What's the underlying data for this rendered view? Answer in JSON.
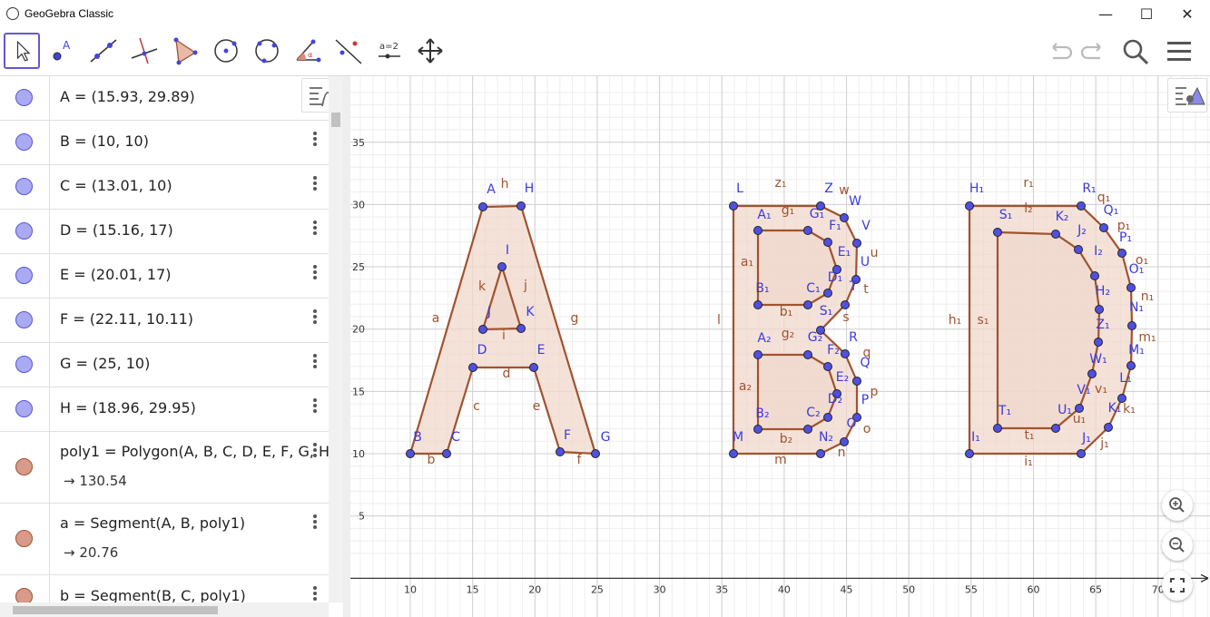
{
  "window": {
    "title": "GeoGebra Classic",
    "minimize": "—",
    "maximize": "☐",
    "close": "✕"
  },
  "toolbar": {
    "tools": [
      "move-tool",
      "point-tool",
      "line-tool",
      "perpendicular-line-tool",
      "polygon-tool",
      "circle-center-point-tool",
      "circle-three-points-tool",
      "angle-tool",
      "reflect-tool",
      "slider-tool",
      "move-graphics-tool"
    ],
    "slider_label": "a=2",
    "accent_color": "#6557d2"
  },
  "algebra": {
    "rows": [
      {
        "expr": "A = (15.93, 29.89)"
      },
      {
        "expr": "B = (10, 10)"
      },
      {
        "expr": "C = (13.01, 10)"
      },
      {
        "expr": "D = (15.16, 17)"
      },
      {
        "expr": "E = (20.01, 17)"
      },
      {
        "expr": "F = (22.11, 10.11)"
      },
      {
        "expr": "G = (25, 10)"
      },
      {
        "expr": "H = (18.96, 29.95)"
      },
      {
        "expr": "poly1 = Polygon(A, B, C, D, E, F, G, H)",
        "value": "→  130.54"
      },
      {
        "expr": "a = Segment(A, B, poly1)",
        "value": "→  20.76"
      },
      {
        "expr": "b = Segment(B, C, poly1)"
      }
    ]
  },
  "graphics": {
    "x_ticks": [
      "10",
      "15",
      "20",
      "25",
      "30",
      "35",
      "40",
      "45",
      "50",
      "55",
      "60",
      "65",
      "70"
    ],
    "y_ticks": [
      "35",
      "30",
      "25",
      "20",
      "15",
      "10",
      "5"
    ],
    "labels": [
      {
        "t": "A",
        "c": "p",
        "x": 541,
        "y": 213
      },
      {
        "t": "H",
        "c": "p",
        "x": 583,
        "y": 212
      },
      {
        "t": "h",
        "c": "s",
        "x": 556,
        "y": 207
      },
      {
        "t": "I",
        "c": "p",
        "x": 559,
        "y": 280
      },
      {
        "t": "k",
        "c": "s",
        "x": 531,
        "y": 320
      },
      {
        "t": "j",
        "c": "s",
        "x": 579,
        "y": 319
      },
      {
        "t": "J",
        "c": "p",
        "x": 539,
        "y": 348
      },
      {
        "t": "K",
        "c": "p",
        "x": 584,
        "y": 348
      },
      {
        "t": "i",
        "c": "s",
        "x": 555,
        "y": 374
      },
      {
        "t": "a",
        "c": "s",
        "x": 480,
        "y": 355
      },
      {
        "t": "g",
        "c": "s",
        "x": 633,
        "y": 355
      },
      {
        "t": "D",
        "c": "p",
        "x": 531,
        "y": 390
      },
      {
        "t": "E",
        "c": "p",
        "x": 596,
        "y": 390
      },
      {
        "t": "d",
        "c": "s",
        "x": 558,
        "y": 416
      },
      {
        "t": "c",
        "c": "s",
        "x": 525,
        "y": 452
      },
      {
        "t": "e",
        "c": "s",
        "x": 591,
        "y": 452
      },
      {
        "t": "B",
        "c": "p",
        "x": 460,
        "y": 486
      },
      {
        "t": "C",
        "c": "p",
        "x": 502,
        "y": 486
      },
      {
        "t": "F",
        "c": "p",
        "x": 625,
        "y": 484
      },
      {
        "t": "G",
        "c": "p",
        "x": 667,
        "y": 486
      },
      {
        "t": "b",
        "c": "s",
        "x": 475,
        "y": 511
      },
      {
        "t": "f",
        "c": "s",
        "x": 638,
        "y": 511
      },
      {
        "t": "L",
        "c": "p",
        "x": 815,
        "y": 212
      },
      {
        "t": "Z",
        "c": "p",
        "x": 913,
        "y": 212
      },
      {
        "t": "W",
        "c": "p",
        "x": 942,
        "y": 226
      },
      {
        "t": "w",
        "c": "s",
        "x": 930,
        "y": 214
      },
      {
        "t": "z₁",
        "c": "s",
        "x": 860,
        "y": 206
      },
      {
        "t": "A₁",
        "c": "p",
        "x": 842,
        "y": 241
      },
      {
        "t": "g₁",
        "c": "s",
        "x": 868,
        "y": 236
      },
      {
        "t": "G₁",
        "c": "p",
        "x": 900,
        "y": 240
      },
      {
        "t": "F₁",
        "c": "p",
        "x": 920,
        "y": 253
      },
      {
        "t": "V",
        "c": "p",
        "x": 954,
        "y": 253
      },
      {
        "t": "E₁",
        "c": "p",
        "x": 930,
        "y": 282
      },
      {
        "t": "U",
        "c": "p",
        "x": 953,
        "y": 293
      },
      {
        "t": "u",
        "c": "s",
        "x": 963,
        "y": 283
      },
      {
        "t": "a₁",
        "c": "s",
        "x": 823,
        "y": 293
      },
      {
        "t": "D₁",
        "c": "p",
        "x": 920,
        "y": 310
      },
      {
        "t": "T",
        "c": "p",
        "x": 940,
        "y": 320
      },
      {
        "t": "t",
        "c": "s",
        "x": 954,
        "y": 323
      },
      {
        "t": "B₁",
        "c": "p",
        "x": 840,
        "y": 322
      },
      {
        "t": "C₁",
        "c": "p",
        "x": 896,
        "y": 322
      },
      {
        "t": "b₁",
        "c": "s",
        "x": 866,
        "y": 348
      },
      {
        "t": "S₁",
        "c": "p",
        "x": 910,
        "y": 347
      },
      {
        "t": "s",
        "c": "s",
        "x": 932,
        "y": 354
      },
      {
        "t": "l",
        "c": "s",
        "x": 792,
        "y": 357
      },
      {
        "t": "A₂",
        "c": "p",
        "x": 842,
        "y": 377
      },
      {
        "t": "g₂",
        "c": "s",
        "x": 868,
        "y": 372
      },
      {
        "t": "G₂",
        "c": "p",
        "x": 898,
        "y": 376
      },
      {
        "t": "R",
        "c": "p",
        "x": 940,
        "y": 376
      },
      {
        "t": "F₂",
        "c": "p",
        "x": 918,
        "y": 390
      },
      {
        "t": "q",
        "c": "s",
        "x": 955,
        "y": 393
      },
      {
        "t": "Q",
        "c": "p",
        "x": 953,
        "y": 404
      },
      {
        "t": "E₂",
        "c": "p",
        "x": 928,
        "y": 420
      },
      {
        "t": "a₂",
        "c": "s",
        "x": 821,
        "y": 430
      },
      {
        "t": "P",
        "c": "p",
        "x": 953,
        "y": 445
      },
      {
        "t": "p",
        "c": "s",
        "x": 963,
        "y": 436
      },
      {
        "t": "D₂",
        "c": "p",
        "x": 920,
        "y": 444
      },
      {
        "t": "B₂",
        "c": "p",
        "x": 840,
        "y": 460
      },
      {
        "t": "C₂",
        "c": "p",
        "x": 896,
        "y": 459
      },
      {
        "t": "O",
        "c": "p",
        "x": 938,
        "y": 471
      },
      {
        "t": "o",
        "c": "s",
        "x": 955,
        "y": 477
      },
      {
        "t": "M",
        "c": "p",
        "x": 813,
        "y": 486
      },
      {
        "t": "N₂",
        "c": "p",
        "x": 910,
        "y": 486
      },
      {
        "t": "b₂",
        "c": "s",
        "x": 866,
        "y": 488
      },
      {
        "t": "m",
        "c": "s",
        "x": 860,
        "y": 511
      },
      {
        "t": "n",
        "c": "s",
        "x": 927,
        "y": 503
      },
      {
        "t": "H₁",
        "c": "p",
        "x": 1076,
        "y": 212
      },
      {
        "t": "r₁",
        "c": "s",
        "x": 1133,
        "y": 206
      },
      {
        "t": "R₁",
        "c": "p",
        "x": 1200,
        "y": 212
      },
      {
        "t": "q₁",
        "c": "s",
        "x": 1216,
        "y": 222
      },
      {
        "t": "Q₁",
        "c": "p",
        "x": 1224,
        "y": 236
      },
      {
        "t": "l₂",
        "c": "s",
        "x": 1133,
        "y": 234
      },
      {
        "t": "S₁",
        "c": "p",
        "x": 1108,
        "y": 241
      },
      {
        "t": "K₂",
        "c": "p",
        "x": 1170,
        "y": 243
      },
      {
        "t": "p₁",
        "c": "s",
        "x": 1238,
        "y": 253
      },
      {
        "t": "P₁",
        "c": "p",
        "x": 1240,
        "y": 266
      },
      {
        "t": "J₂",
        "c": "p",
        "x": 1192,
        "y": 258
      },
      {
        "t": "I₂",
        "c": "p",
        "x": 1210,
        "y": 281
      },
      {
        "t": "o₁",
        "c": "s",
        "x": 1258,
        "y": 291
      },
      {
        "t": "O₁",
        "c": "p",
        "x": 1252,
        "y": 301
      },
      {
        "t": "H₂",
        "c": "p",
        "x": 1215,
        "y": 325
      },
      {
        "t": "n₁",
        "c": "s",
        "x": 1264,
        "y": 331
      },
      {
        "t": "N₁",
        "c": "p",
        "x": 1252,
        "y": 343
      },
      {
        "t": "h₁",
        "c": "s",
        "x": 1052,
        "y": 357
      },
      {
        "t": "s₁",
        "c": "s",
        "x": 1083,
        "y": 357
      },
      {
        "t": "Z₁",
        "c": "p",
        "x": 1215,
        "y": 362
      },
      {
        "t": "m₁",
        "c": "s",
        "x": 1264,
        "y": 376
      },
      {
        "t": "M₁",
        "c": "p",
        "x": 1252,
        "y": 390
      },
      {
        "t": "W₁",
        "c": "p",
        "x": 1210,
        "y": 400
      },
      {
        "t": "L₁",
        "c": "p",
        "x": 1240,
        "y": 421
      },
      {
        "t": "V₁",
        "c": "p",
        "x": 1194,
        "y": 434
      },
      {
        "t": "v₁",
        "c": "s",
        "x": 1213,
        "y": 433
      },
      {
        "t": "k₁",
        "c": "s",
        "x": 1244,
        "y": 455
      },
      {
        "t": "K₁",
        "c": "p",
        "x": 1228,
        "y": 454
      },
      {
        "t": "T₁",
        "c": "p",
        "x": 1107,
        "y": 457
      },
      {
        "t": "U₁",
        "c": "p",
        "x": 1173,
        "y": 456
      },
      {
        "t": "u₁",
        "c": "s",
        "x": 1189,
        "y": 466
      },
      {
        "t": "I₁",
        "c": "p",
        "x": 1075,
        "y": 486
      },
      {
        "t": "t₁",
        "c": "s",
        "x": 1134,
        "y": 484
      },
      {
        "t": "J₁",
        "c": "p",
        "x": 1197,
        "y": 487
      },
      {
        "t": "j₁",
        "c": "s",
        "x": 1217,
        "y": 493
      },
      {
        "t": "i₁",
        "c": "s",
        "x": 1133,
        "y": 513
      }
    ]
  },
  "colors": {
    "poly_fill": "#f0d8cc",
    "poly_stroke": "#a0532f",
    "point_fill": "#5050e0",
    "point_label": "#3b3bdb",
    "seg_label": "#a0532f",
    "grid": "#d0d0d0",
    "grid_minor": "#eeeeee"
  }
}
